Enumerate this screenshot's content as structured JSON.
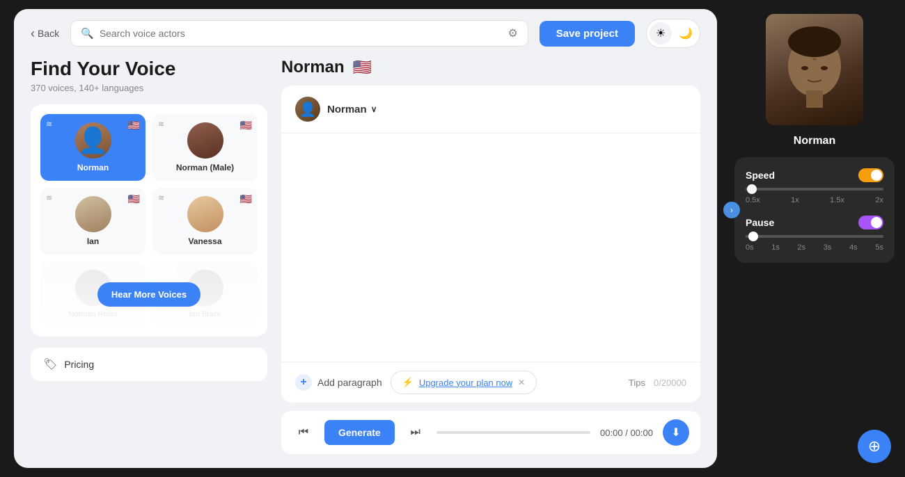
{
  "header": {
    "back_label": "Back",
    "search_placeholder": "Search voice actors",
    "save_label": "Save project",
    "theme_light_icon": "☀",
    "theme_dark_icon": "🌙"
  },
  "sidebar": {
    "title": "Find Your Voice",
    "subtitle": "370 voices, 140+ languages",
    "voices": [
      {
        "name": "Norman",
        "flag": "🇺🇸",
        "selected": true
      },
      {
        "name": "Norman (Male)",
        "flag": "🇺🇸",
        "selected": false
      },
      {
        "name": "Ian",
        "flag": "🇺🇸",
        "selected": false
      },
      {
        "name": "Vanessa",
        "flag": "🇺🇸",
        "selected": false
      }
    ],
    "hear_more_label": "Hear More Voices",
    "pricing_label": "Pricing"
  },
  "main": {
    "selected_voice": "Norman",
    "selected_flag": "🇺🇸",
    "voice_dropdown_label": "Norman",
    "text_placeholder": "",
    "add_paragraph_label": "Add paragraph",
    "upgrade_label": "Upgrade your plan now",
    "tips_label": "Tips",
    "char_count": "0/20000",
    "generate_label": "Generate",
    "time_current": "00:00",
    "time_total": "00:00"
  },
  "right_panel": {
    "name": "Norman",
    "speed_label": "Speed",
    "pause_label": "Pause",
    "speed_marks": [
      "0.5x",
      "1x",
      "1.5x",
      "2x"
    ],
    "pause_marks": [
      "0s",
      "1s",
      "2s",
      "3s",
      "4s",
      "5s"
    ]
  },
  "icons": {
    "back_chevron": "‹",
    "search": "🔍",
    "filter": "⚙",
    "waves": "≋",
    "tag": "🏷",
    "plus": "+",
    "lightning": "⚡",
    "close": "✕",
    "chevron_down": "∨",
    "skip_back": "⏮",
    "skip_forward": "⏭",
    "download": "⬇",
    "chevron_right": "›",
    "help": "⊕"
  }
}
